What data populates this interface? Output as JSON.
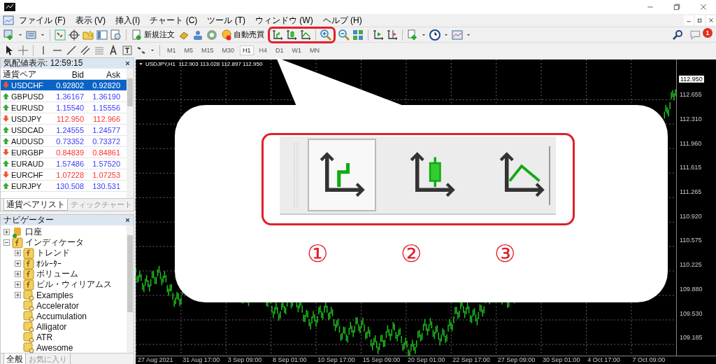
{
  "menu": [
    "ファイル (F)",
    "表示 (V)",
    "挿入(I)",
    "チャート (C)",
    "ツール (T)",
    "ウィンドウ (W)",
    "ヘルプ (H)"
  ],
  "toolbar": {
    "new_order": "新規注文",
    "auto_trading": "自動売買",
    "notifications": "1"
  },
  "timeframes": [
    {
      "label": "M1",
      "selected": false
    },
    {
      "label": "M5",
      "selected": false
    },
    {
      "label": "M15",
      "selected": false
    },
    {
      "label": "M30",
      "selected": false
    },
    {
      "label": "H1",
      "selected": true
    },
    {
      "label": "H4",
      "selected": false
    },
    {
      "label": "D1",
      "selected": false
    },
    {
      "label": "W1",
      "selected": false
    },
    {
      "label": "MN",
      "selected": false
    }
  ],
  "market_watch": {
    "title": "気配値表示: 12:59:15",
    "columns": [
      "通貨ペア",
      "Bid",
      "Ask"
    ],
    "rows": [
      {
        "symbol": "USDCHF",
        "bid": "0.92802",
        "ask": "0.92820",
        "rising": false,
        "selected": true
      },
      {
        "symbol": "GBPUSD",
        "bid": "1.36167",
        "ask": "1.36190",
        "rising": true,
        "selected": false
      },
      {
        "symbol": "EURUSD",
        "bid": "1.15540",
        "ask": "1.15556",
        "rising": true,
        "selected": false
      },
      {
        "symbol": "USDJPY",
        "bid": "112.950",
        "ask": "112.966",
        "rising": false,
        "selected": false
      },
      {
        "symbol": "USDCAD",
        "bid": "1.24555",
        "ask": "1.24577",
        "rising": true,
        "selected": false
      },
      {
        "symbol": "AUDUSD",
        "bid": "0.73352",
        "ask": "0.73372",
        "rising": true,
        "selected": false
      },
      {
        "symbol": "EURGBP",
        "bid": "0.84839",
        "ask": "0.84861",
        "rising": false,
        "selected": false
      },
      {
        "symbol": "EURAUD",
        "bid": "1.57486",
        "ask": "1.57520",
        "rising": true,
        "selected": false
      },
      {
        "symbol": "EURCHF",
        "bid": "1.07228",
        "ask": "1.07253",
        "rising": false,
        "selected": false
      },
      {
        "symbol": "EURJPY",
        "bid": "130.508",
        "ask": "130.531",
        "rising": true,
        "selected": false
      }
    ],
    "tabs": [
      {
        "label": "通貨ペアリスト",
        "selected": true
      },
      {
        "label": "ティックチャート",
        "selected": false
      }
    ]
  },
  "navigator": {
    "title": "ナビゲーター",
    "tree": [
      {
        "label": "口座",
        "kind": "account",
        "expanded": false
      },
      {
        "label": "インディケータ",
        "kind": "folder",
        "expanded": true,
        "children": [
          {
            "label": "トレンド",
            "kind": "folder",
            "expanded": false
          },
          {
            "label": "ｵｼﾚｰﾀｰ",
            "kind": "folder",
            "expanded": false
          },
          {
            "label": "ボリューム",
            "kind": "folder",
            "expanded": false
          },
          {
            "label": "ビル・ウィリアムス",
            "kind": "folder",
            "expanded": false
          },
          {
            "label": "Examples",
            "kind": "indicator-folder",
            "expanded": false
          },
          {
            "label": "Accelerator",
            "kind": "indicator"
          },
          {
            "label": "Accumulation",
            "kind": "indicator"
          },
          {
            "label": "Alligator",
            "kind": "indicator"
          },
          {
            "label": "ATR",
            "kind": "indicator"
          },
          {
            "label": "Awesome",
            "kind": "indicator"
          }
        ]
      }
    ],
    "tabs": [
      {
        "label": "全般",
        "selected": true
      },
      {
        "label": "お気に入り",
        "selected": false
      }
    ]
  },
  "chart": {
    "title": "USDJPY,H1  112.903 113.028 112.897 112.950",
    "current_price": "112.950",
    "price_ticks": [
      "112.655",
      "112.310",
      "111.960",
      "111.615",
      "111.265",
      "110.920",
      "110.575",
      "110.225",
      "109.880",
      "109.530",
      "109.185"
    ],
    "time_ticks": [
      "27 Aug 2021",
      "31 Aug 17:00",
      "3 Sep 09:00",
      "8 Sep 01:00",
      "10 Sep 17:00",
      "15 Sep 09:00",
      "20 Sep 01:00",
      "22 Sep 17:00",
      "27 Sep 09:00",
      "30 Sep 01:00",
      "4 Oct 17:00",
      "7 Oct 09:00"
    ]
  },
  "callout": {
    "numbers": [
      "①",
      "②",
      "③"
    ]
  }
}
